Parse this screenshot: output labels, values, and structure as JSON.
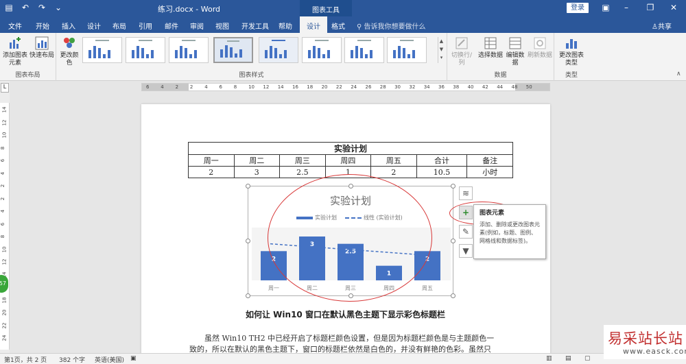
{
  "titlebar": {
    "doc_title": "练习.docx - Word",
    "chart_tools": "图表工具",
    "login": "登录",
    "quick_access": [
      "save-icon",
      "undo-icon",
      "redo-icon",
      "customize-icon"
    ]
  },
  "tabs": [
    {
      "label": "文件",
      "active": false
    },
    {
      "label": "开始",
      "active": false
    },
    {
      "label": "插入",
      "active": false
    },
    {
      "label": "设计",
      "active": false
    },
    {
      "label": "布局",
      "active": false
    },
    {
      "label": "引用",
      "active": false
    },
    {
      "label": "邮件",
      "active": false
    },
    {
      "label": "审阅",
      "active": false
    },
    {
      "label": "视图",
      "active": false
    },
    {
      "label": "开发工具",
      "active": false
    },
    {
      "label": "帮助",
      "active": false
    },
    {
      "label": "设计",
      "active": true
    },
    {
      "label": "格式",
      "active": false
    }
  ],
  "tell_me": "告诉我你想要做什么",
  "share": "共享",
  "ribbon": {
    "layout_group": {
      "label": "图表布局",
      "add_element": "添加图表元素",
      "quick_layout": "快速布局"
    },
    "styles_group": {
      "label": "图表样式",
      "change_colors": "更改颜色"
    },
    "data_group": {
      "label": "数据",
      "switch_row_col": "切换行/列",
      "select_data": "选择数据",
      "edit_data": "编辑数据",
      "refresh_data": "刷新数据"
    },
    "type_group": {
      "label": "类型",
      "change_type": "更改图表类型"
    }
  },
  "ruler": {
    "h_ticks": [
      "6",
      "4",
      "2",
      "2",
      "4",
      "6",
      "8",
      "10",
      "12",
      "14",
      "16",
      "18",
      "20",
      "22",
      "24",
      "26",
      "28",
      "30",
      "32",
      "34",
      "36",
      "38",
      "40",
      "42",
      "44",
      "48",
      "50"
    ],
    "v_ticks": [
      "14",
      "12",
      "10",
      "8",
      "6",
      "4",
      "2",
      "2",
      "4",
      "6",
      "8",
      "10",
      "12",
      "14",
      "16",
      "18",
      "20",
      "22",
      "24"
    ]
  },
  "green_badge": "57",
  "table": {
    "title": "实验计划",
    "headers": [
      "周一",
      "周二",
      "周三",
      "周四",
      "周五",
      "合计",
      "备注"
    ],
    "values": [
      "2",
      "3",
      "2.5",
      "1",
      "2",
      "10.5",
      "小时"
    ]
  },
  "chart_data": {
    "type": "bar",
    "title": "实验计划",
    "categories": [
      "周一",
      "周二",
      "周三",
      "周四",
      "周五"
    ],
    "series": [
      {
        "name": "实验计划",
        "values": [
          2,
          3,
          2.5,
          1,
          2
        ]
      }
    ],
    "trendline": {
      "name": "线性 (实验计划)",
      "style": "dashed"
    },
    "data_labels": true,
    "bar_color": "#4472c4",
    "ylim": [
      0,
      3
    ]
  },
  "tooltip": {
    "title": "图表元素",
    "body": "添加、删除或更改图表元素(例如，标题、图例、网格线和数据标签)。"
  },
  "side_buttons": [
    "layout-options-icon",
    "plus-icon",
    "brush-icon",
    "filter-icon"
  ],
  "heading": "如何让 Win10 窗口在默认黑色主题下显示彩色标题栏",
  "paragraph": {
    "line1": "虽然 Win10 TH2 中已经开启了标题栏颜色设置，但是因为标题栏颜色是与主题颜色一",
    "line2": "致的，所以在默认的黑色主题下，窗口的标题栏依然是白色的，并没有鲜艳的色彩。虽然只"
  },
  "statusbar": {
    "page": "第1页，共 2 页",
    "words": "382 个字",
    "language": "英语(美国)"
  },
  "watermark": {
    "cn": "易采站长站",
    "en": "www.easck.com"
  },
  "colors": {
    "brand": "#2b579a",
    "bar": "#4472c4",
    "annotation": "#d83838"
  }
}
